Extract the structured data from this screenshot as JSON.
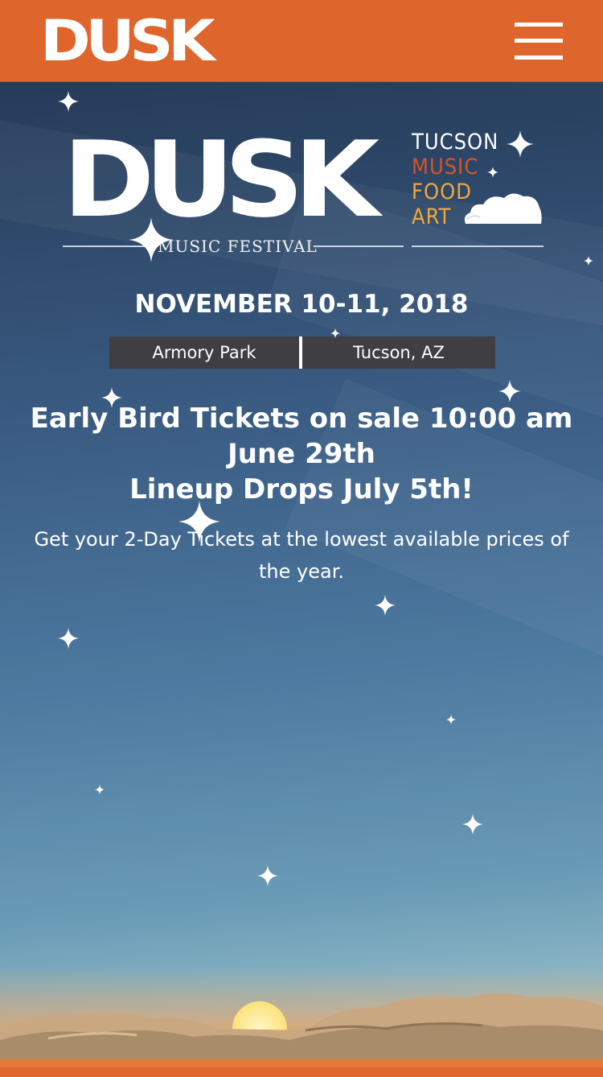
{
  "header": {
    "logo_text": "DUSK",
    "menu_icon": "hamburger-menu-icon"
  },
  "festival_logo": {
    "name": "DUSK",
    "subtitle": "MUSIC FESTIVAL",
    "words": [
      "TUCSON",
      "MUSIC",
      "FOOD",
      "ART"
    ],
    "word_colors": [
      "#ffffff",
      "#d9532a",
      "#f2a93b",
      "#f2a93b"
    ]
  },
  "event": {
    "date": "NOVEMBER 10-11, 2018",
    "venue": "Armory Park",
    "city": "Tucson, AZ"
  },
  "headline": {
    "lines": [
      "Early Bird Tickets on sale 10:00 am",
      "June 29th",
      "Lineup Drops July 5th!"
    ]
  },
  "subtext": "Get your 2-Day Tickets at the lowest available prices of the year.",
  "colors": {
    "header_bg": "#de652c",
    "venue_bar_bg": "#3e3e43"
  }
}
